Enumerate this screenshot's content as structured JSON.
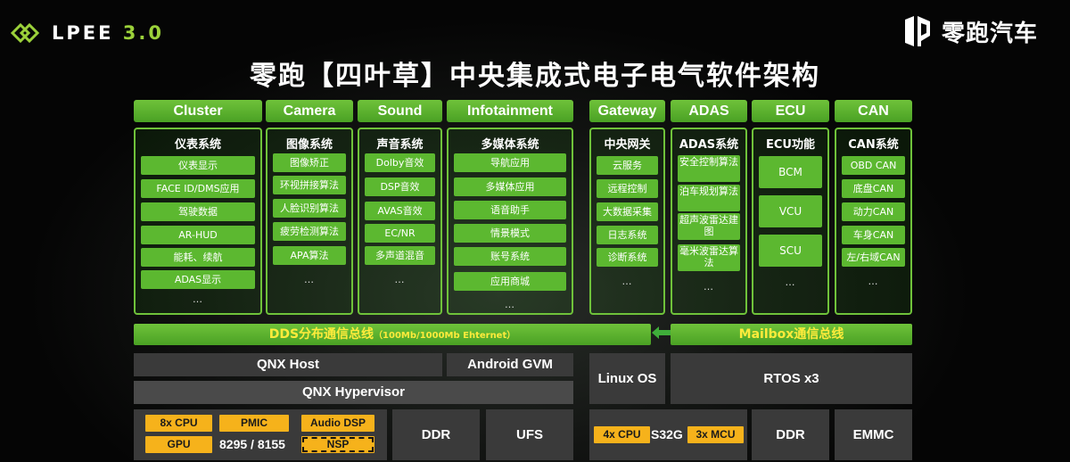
{
  "logo_left": {
    "text": "LPEE",
    "version": "3.0"
  },
  "logo_right": {
    "text": "零跑汽车"
  },
  "title": "零跑【四叶草】中央集成式电子电气软件架构",
  "columns": [
    {
      "header": "Cluster",
      "title": "仪表系统",
      "items": [
        "仪表显示",
        "FACE ID/DMS应用",
        "驾驶数据",
        "AR-HUD",
        "能耗、续航",
        "ADAS显示"
      ],
      "more": "…"
    },
    {
      "header": "Camera",
      "title": "图像系统",
      "items": [
        "图像矫正",
        "环视拼接算法",
        "人脸识别算法",
        "疲劳检测算法",
        "APA算法"
      ],
      "more": "…"
    },
    {
      "header": "Sound",
      "title": "声音系统",
      "items": [
        "Dolby音效",
        "DSP音效",
        "AVAS音效",
        "EC/NR",
        "多声道混音"
      ],
      "more": "…"
    },
    {
      "header": "Infotainment",
      "title": "多媒体系统",
      "items": [
        "导航应用",
        "多媒体应用",
        "语音助手",
        "情景模式",
        "账号系统",
        "应用商城"
      ],
      "more": "…"
    },
    {
      "header": "Gateway",
      "title": "中央网关",
      "items": [
        "云服务",
        "远程控制",
        "大数据采集",
        "日志系统",
        "诊断系统"
      ],
      "more": "…"
    },
    {
      "header": "ADAS",
      "title": "ADAS系统",
      "items": [
        "安全控制算法",
        "泊车规划算法",
        "超声波雷达建图",
        "毫米波雷达算法"
      ],
      "more": "…"
    },
    {
      "header": "ECU",
      "title": "ECU功能",
      "items": [
        "BCM",
        "VCU",
        "SCU"
      ],
      "more": "…"
    },
    {
      "header": "CAN",
      "title": "CAN系统",
      "items": [
        "OBD CAN",
        "底盘CAN",
        "动力CAN",
        "车身CAN",
        "左/右域CAN"
      ],
      "more": "…"
    }
  ],
  "bus": {
    "dds": "DDS分布通信总线",
    "dds_note": "（100Mb/1000Mb Ehternet）",
    "mailbox": "Mailbox通信总线"
  },
  "os": {
    "qnx_host": "QNX  Host",
    "android": "Android GVM",
    "hypervisor": "QNX  Hypervisor",
    "linux": "Linux OS",
    "rtos": "RTOS x3"
  },
  "hw": {
    "soc_chips": [
      "8x CPU",
      "PMIC",
      "Audio DSP",
      "GPU",
      "NSP"
    ],
    "soc_name": "8295 / 8155",
    "ddr1": "DDR",
    "ufs": "UFS",
    "mcu_chips": [
      "4x CPU",
      "3x MCU"
    ],
    "mcu_name": "S32G",
    "ddr2": "DDR",
    "emmc": "EMMC"
  },
  "colors": {
    "accent_green": "#5cb830",
    "chip_orange": "#f6b21b",
    "bus_text": "#ffeb3b",
    "block_gray": "#3a3a3a"
  }
}
